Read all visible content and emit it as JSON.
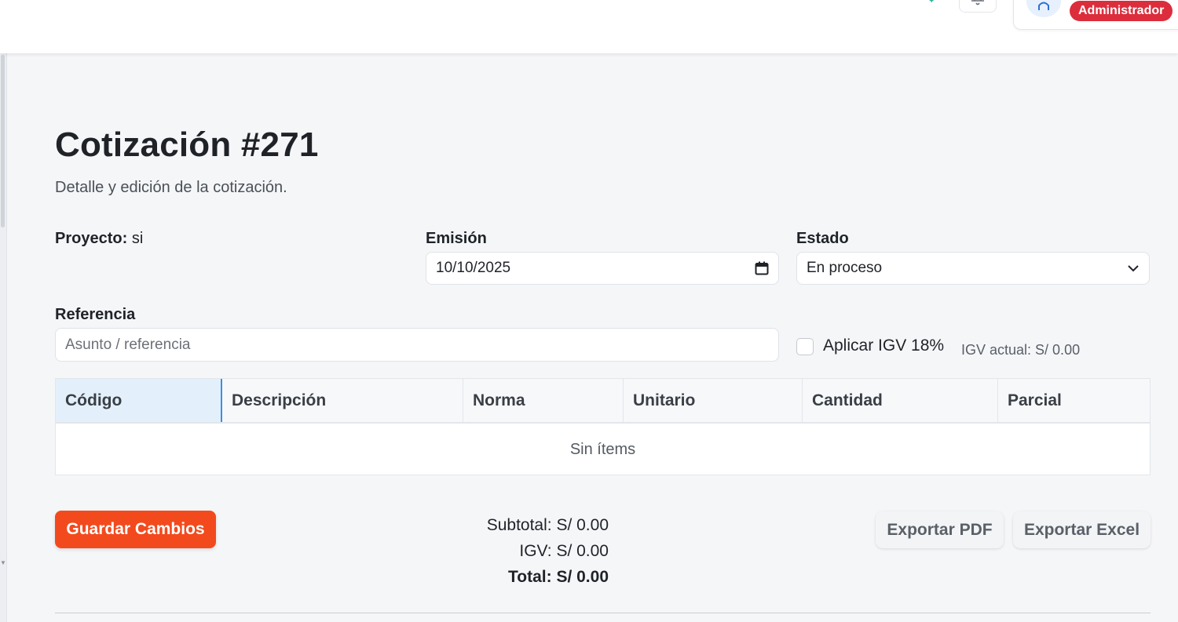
{
  "header": {
    "role_badge": "Administrador"
  },
  "page": {
    "title": "Cotización #271",
    "subtitle": "Detalle y edición de la cotización."
  },
  "form": {
    "project_label": "Proyecto:",
    "project_value": "si",
    "emission_label": "Emisión",
    "emission_value": "10/10/2025",
    "status_label": "Estado",
    "status_value": "En proceso",
    "reference_label": "Referencia",
    "reference_placeholder": "Asunto / referencia",
    "igv_checkbox_label": "Aplicar IGV 18%",
    "igv_checked": false,
    "igv_current": "IGV actual: S/ 0.00"
  },
  "table": {
    "columns": [
      "Código",
      "Descripción",
      "Norma",
      "Unitario",
      "Cantidad",
      "Parcial"
    ],
    "empty_text": "Sin ítems"
  },
  "totals": {
    "subtotal": "Subtotal: S/ 0.00",
    "igv": "IGV: S/ 0.00",
    "total": "Total: S/ 0.00"
  },
  "actions": {
    "save": "Guardar Cambios",
    "export_pdf": "Exportar PDF",
    "export_excel": "Exportar Excel"
  },
  "colors": {
    "accent": "#f34a1d",
    "badge": "#dc2d3c"
  }
}
